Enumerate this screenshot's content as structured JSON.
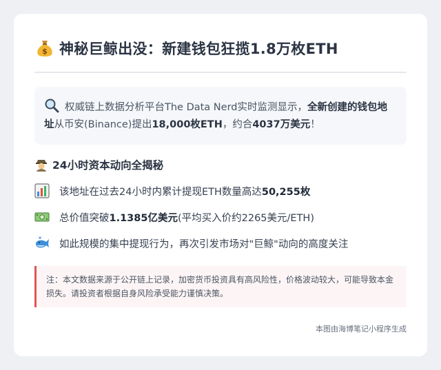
{
  "title": "神秘巨鲸出没：新建钱包狂揽1.8万枚ETH",
  "icons": {
    "title": "money-bag-icon",
    "highlight": "magnifier-icon",
    "section": "detective-icon",
    "bullet1": "bar-chart-icon",
    "bullet2": "banknote-icon",
    "bullet3": "whale-icon"
  },
  "highlight": {
    "part1": "权威链上数据分析平台The Data Nerd实时监测显示，",
    "bold1": "全新创建的钱包地址",
    "part2": "从币安(Binance)提出",
    "bold2": "18,000枚ETH",
    "part3": "，约合",
    "bold3": "4037万美元",
    "part4": "！"
  },
  "section_title": "24小时资本动向全揭秘",
  "bullets": [
    {
      "text": "该地址在过去24小时内累计提现ETH数量高达",
      "bold": "50,255枚",
      "tail": ""
    },
    {
      "text": "总价值突破",
      "bold": "1.1385亿美元",
      "tail": "(平均买入价约2265美元/ETH)"
    },
    {
      "text": "如此规模的集中提现行为，再次引发市场对\"巨鲸\"动向的高度关注",
      "bold": "",
      "tail": ""
    }
  ],
  "note": "注：本文数据来源于公开链上记录，加密货币投资具有高风险性，价格波动较大，可能导致本金损失。请投资者根据自身风险承受能力谨慎决策。",
  "footer": "本图由海博笔记小程序生成",
  "colors": {
    "background": "#eef0f4",
    "card": "#ffffff",
    "note_border": "#e05555",
    "note_bg": "#fdf5f5"
  }
}
